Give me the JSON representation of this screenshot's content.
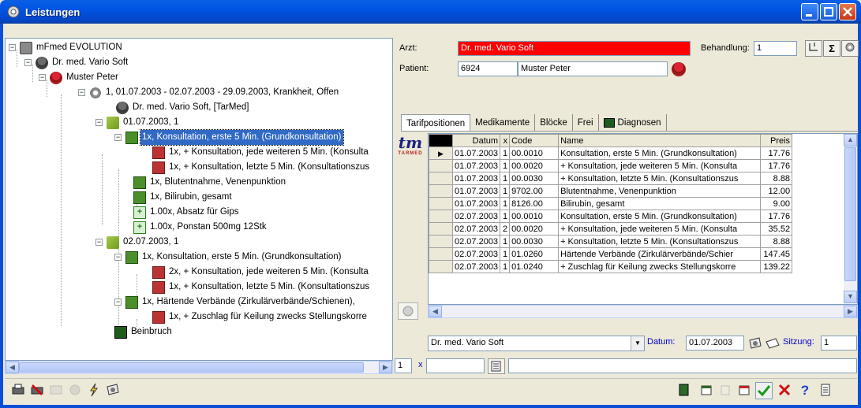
{
  "window": {
    "title": "Leistungen"
  },
  "tree": {
    "rows": [
      {
        "label": "mFmed EVOLUTION",
        "icon": "monitor-icon"
      },
      {
        "label": "Dr. med. Vario Soft",
        "icon": "doctor-icon"
      },
      {
        "label": "Muster Peter",
        "icon": "patient-icon"
      },
      {
        "label": "1,  01.07.2003 - 02.07.2003 - 29.09.2003, Krankheit, Offen",
        "icon": "gear-icon"
      },
      {
        "label": "Dr. med. Vario Soft, [TarMed]",
        "icon": "doctor-icon"
      },
      {
        "label": "01.07.2003, 1",
        "icon": "folder-icon"
      },
      {
        "label": "1x, Konsultation, erste 5 Min. (Grundkonsultation)",
        "icon": "position-icon"
      },
      {
        "label": "1x, + Konsultation, jede weiteren 5 Min. (Konsulta",
        "icon": "sub-position-icon"
      },
      {
        "label": "1x, + Konsultation, letzte 5 Min. (Konsultationszus",
        "icon": "sub-position-icon"
      },
      {
        "label": "1x, Blutentnahme, Venenpunktion",
        "icon": "position-icon"
      },
      {
        "label": "1x, Bilirubin, gesamt",
        "icon": "position-icon"
      },
      {
        "label": "1.00x, Absatz für Gips",
        "icon": "medication-icon"
      },
      {
        "label": "1.00x, Ponstan 500mg 12Stk",
        "icon": "medication-icon"
      },
      {
        "label": "02.07.2003, 1",
        "icon": "folder-icon"
      },
      {
        "label": "1x, Konsultation, erste 5 Min. (Grundkonsultation)",
        "icon": "position-icon"
      },
      {
        "label": "2x, + Konsultation, jede weiteren 5 Min. (Konsulta",
        "icon": "sub-position-icon"
      },
      {
        "label": "1x, + Konsultation, letzte 5 Min. (Konsultationszus",
        "icon": "sub-position-icon"
      },
      {
        "label": "1x, Härtende Verbände (Zirkulärverbände/Schienen),",
        "icon": "position-icon"
      },
      {
        "label": "1x, + Zuschlag für Keilung zwecks Stellungskorre",
        "icon": "sub-position-icon"
      },
      {
        "label": "Beinbruch",
        "icon": "diagnosis-icon"
      }
    ]
  },
  "form": {
    "arzt_label": "Arzt:",
    "arzt_value": "Dr. med. Vario Soft",
    "behandlung_label": "Behandlung:",
    "behandlung_value": "1",
    "patient_label": "Patient:",
    "patient_id": "6924",
    "patient_name": "Muster Peter",
    "sigma": "Σ"
  },
  "tabs": [
    {
      "label": "Tarifpositionen"
    },
    {
      "label": "Medikamente"
    },
    {
      "label": "Blöcke"
    },
    {
      "label": "Frei"
    },
    {
      "label": "Diagnosen"
    }
  ],
  "logo": {
    "text": "tm",
    "sub": "TARMED"
  },
  "grid": {
    "headers": [
      "Datum",
      "x",
      "Code",
      "Name",
      "Preis"
    ],
    "rows": [
      [
        "01.07.2003",
        "1",
        "00.0010",
        "Konsultation, erste 5 Min. (Grundkonsultation)",
        "17.76"
      ],
      [
        "01.07.2003",
        "1",
        "00.0020",
        "+ Konsultation, jede weiteren 5 Min. (Konsulta",
        "17.76"
      ],
      [
        "01.07.2003",
        "1",
        "00.0030",
        "+ Konsultation, letzte 5 Min. (Konsultationszus",
        "8.88"
      ],
      [
        "01.07.2003",
        "1",
        "9702.00",
        "Blutentnahme, Venenpunktion",
        "12.00"
      ],
      [
        "01.07.2003",
        "1",
        "8126.00",
        "Bilirubin, gesamt",
        "9.00"
      ],
      [
        "02.07.2003",
        "1",
        "00.0010",
        "Konsultation, erste 5 Min. (Grundkonsultation)",
        "17.76"
      ],
      [
        "02.07.2003",
        "2",
        "00.0020",
        "+ Konsultation, jede weiteren 5 Min. (Konsulta",
        "35.52"
      ],
      [
        "02.07.2003",
        "1",
        "00.0030",
        "+ Konsultation, letzte 5 Min. (Konsultationszus",
        "8.88"
      ],
      [
        "02.07.2003",
        "1",
        "01.0260",
        "Härtende Verbände (Zirkulärverbände/Schier",
        "147.45"
      ],
      [
        "02.07.2003",
        "1",
        "01.0240",
        "+ Zuschlag für Keilung zwecks Stellungskorre",
        "139.22"
      ]
    ]
  },
  "footer": {
    "doctor_select": "Dr. med. Vario Soft",
    "datum_label": "Datum:",
    "datum_value": "01.07.2003",
    "sitzung_label": "Sitzung:",
    "sitzung_value": "1",
    "qty_value": "1",
    "x_mark": "x"
  }
}
